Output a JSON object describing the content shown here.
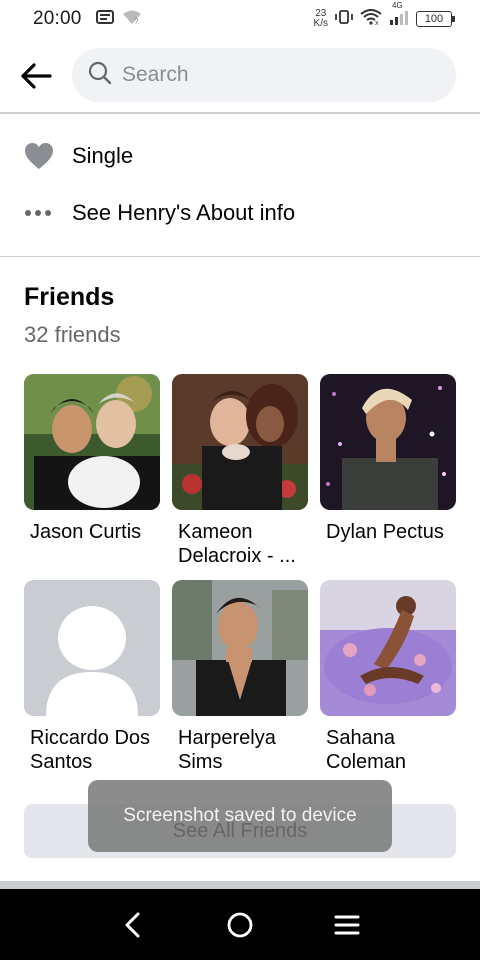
{
  "status_bar": {
    "time": "20:00",
    "speed_value": "23",
    "speed_unit": "K/s",
    "network": "4G",
    "battery": "100"
  },
  "header": {
    "search_placeholder": "Search"
  },
  "about": {
    "relationship": "Single",
    "see_about": "See Henry's About info"
  },
  "friends": {
    "title": "Friends",
    "count": "32 friends",
    "items": [
      {
        "name": "Jason Curtis"
      },
      {
        "name": "Kameon Delacroix - ..."
      },
      {
        "name": "Dylan Pectus"
      },
      {
        "name": "Riccardo Dos Santos"
      },
      {
        "name": "Harperelya Sims"
      },
      {
        "name": "Sahana Coleman"
      }
    ],
    "see_all_label": "See All Friends"
  },
  "toast": {
    "message": "Screenshot saved to device"
  },
  "colors": {
    "search_bg": "#f0f2f5",
    "secondary_text": "#65676b",
    "button_bg": "#e4e6eb",
    "divider": "#ced0d4"
  }
}
